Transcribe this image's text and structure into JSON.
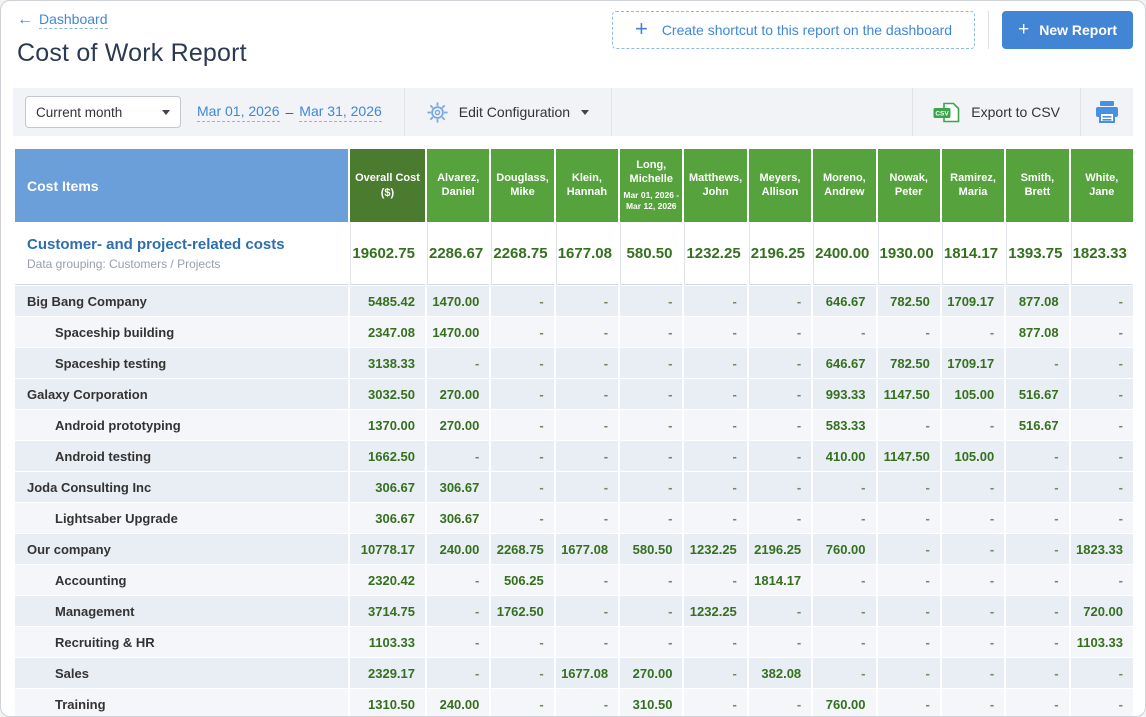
{
  "header": {
    "back_link": "Dashboard",
    "title": "Cost of Work Report",
    "create_shortcut_label": "Create shortcut to this report on the dashboard",
    "new_report_label": "New Report"
  },
  "toolbar": {
    "period_selector": "Current month",
    "date_from": "Mar 01, 2026",
    "date_separator": "–",
    "date_to": "Mar 31, 2026",
    "edit_config_label": "Edit Configuration",
    "export_csv_label": "Export to CSV",
    "csv_icon_text": "CSV"
  },
  "table": {
    "first_col_header": "Cost Items",
    "overall_col_header": "Overall Cost ($)",
    "person_columns": [
      {
        "name": "Alvarez, Daniel"
      },
      {
        "name": "Douglass, Mike"
      },
      {
        "name": "Klein, Hannah"
      },
      {
        "name": "Long, Michelle",
        "note": "Mar 01, 2026 - Mar 12, 2026"
      },
      {
        "name": "Matthews, John"
      },
      {
        "name": "Meyers, Allison"
      },
      {
        "name": "Moreno, Andrew"
      },
      {
        "name": "Nowak, Peter"
      },
      {
        "name": "Ramirez, Maria"
      },
      {
        "name": "Smith, Brett"
      },
      {
        "name": "White, Jane"
      }
    ],
    "summary": {
      "title": "Customer- and project-related costs",
      "subtitle": "Data grouping: Customers / Projects",
      "overall": "19602.75",
      "values": [
        "2286.67",
        "2268.75",
        "1677.08",
        "580.50",
        "1232.25",
        "2196.25",
        "2400.00",
        "1930.00",
        "1814.17",
        "1393.75",
        "1823.33"
      ]
    },
    "rows": [
      {
        "label": "Big Bang Company",
        "level": 0,
        "overall": "5485.42",
        "values": [
          "1470.00",
          "-",
          "-",
          "-",
          "-",
          "-",
          "646.67",
          "782.50",
          "1709.17",
          "877.08",
          "-"
        ]
      },
      {
        "label": "Spaceship building",
        "level": 1,
        "overall": "2347.08",
        "values": [
          "1470.00",
          "-",
          "-",
          "-",
          "-",
          "-",
          "-",
          "-",
          "-",
          "877.08",
          "-"
        ]
      },
      {
        "label": "Spaceship testing",
        "level": 1,
        "overall": "3138.33",
        "values": [
          "-",
          "-",
          "-",
          "-",
          "-",
          "-",
          "646.67",
          "782.50",
          "1709.17",
          "-",
          "-"
        ]
      },
      {
        "label": "Galaxy Corporation",
        "level": 0,
        "overall": "3032.50",
        "values": [
          "270.00",
          "-",
          "-",
          "-",
          "-",
          "-",
          "993.33",
          "1147.50",
          "105.00",
          "516.67",
          "-"
        ]
      },
      {
        "label": "Android prototyping",
        "level": 1,
        "overall": "1370.00",
        "values": [
          "270.00",
          "-",
          "-",
          "-",
          "-",
          "-",
          "583.33",
          "-",
          "-",
          "516.67",
          "-"
        ]
      },
      {
        "label": "Android testing",
        "level": 1,
        "overall": "1662.50",
        "values": [
          "-",
          "-",
          "-",
          "-",
          "-",
          "-",
          "410.00",
          "1147.50",
          "105.00",
          "-",
          "-"
        ]
      },
      {
        "label": "Joda Consulting Inc",
        "level": 0,
        "overall": "306.67",
        "values": [
          "306.67",
          "-",
          "-",
          "-",
          "-",
          "-",
          "-",
          "-",
          "-",
          "-",
          "-"
        ]
      },
      {
        "label": "Lightsaber Upgrade",
        "level": 1,
        "overall": "306.67",
        "values": [
          "306.67",
          "-",
          "-",
          "-",
          "-",
          "-",
          "-",
          "-",
          "-",
          "-",
          "-"
        ]
      },
      {
        "label": "Our company",
        "level": 0,
        "overall": "10778.17",
        "values": [
          "240.00",
          "2268.75",
          "1677.08",
          "580.50",
          "1232.25",
          "2196.25",
          "760.00",
          "-",
          "-",
          "-",
          "1823.33"
        ]
      },
      {
        "label": "Accounting",
        "level": 1,
        "overall": "2320.42",
        "values": [
          "-",
          "506.25",
          "-",
          "-",
          "-",
          "1814.17",
          "-",
          "-",
          "-",
          "-",
          "-"
        ]
      },
      {
        "label": "Management",
        "level": 1,
        "overall": "3714.75",
        "values": [
          "-",
          "1762.50",
          "-",
          "-",
          "1232.25",
          "-",
          "-",
          "-",
          "-",
          "-",
          "720.00"
        ]
      },
      {
        "label": "Recruiting & HR",
        "level": 1,
        "overall": "1103.33",
        "values": [
          "-",
          "-",
          "-",
          "-",
          "-",
          "-",
          "-",
          "-",
          "-",
          "-",
          "1103.33"
        ]
      },
      {
        "label": "Sales",
        "level": 1,
        "overall": "2329.17",
        "values": [
          "-",
          "-",
          "1677.08",
          "270.00",
          "-",
          "382.08",
          "-",
          "-",
          "-",
          "-",
          "-"
        ]
      },
      {
        "label": "Training",
        "level": 1,
        "overall": "1310.50",
        "values": [
          "240.00",
          "-",
          "-",
          "310.50",
          "-",
          "-",
          "760.00",
          "-",
          "-",
          "-",
          "-"
        ]
      }
    ]
  },
  "colors": {
    "accent_blue": "#4285d4",
    "link_blue": "#3f87d9",
    "header_blue": "#6b9fd9",
    "header_green_dark": "#4b7b2f",
    "header_green": "#56a23c",
    "value_green": "#35701f",
    "csv_green": "#3aa54a",
    "printer_blue": "#4a90e2",
    "row_dark": "#e9edf4",
    "row_light": "#f4f6fa"
  }
}
